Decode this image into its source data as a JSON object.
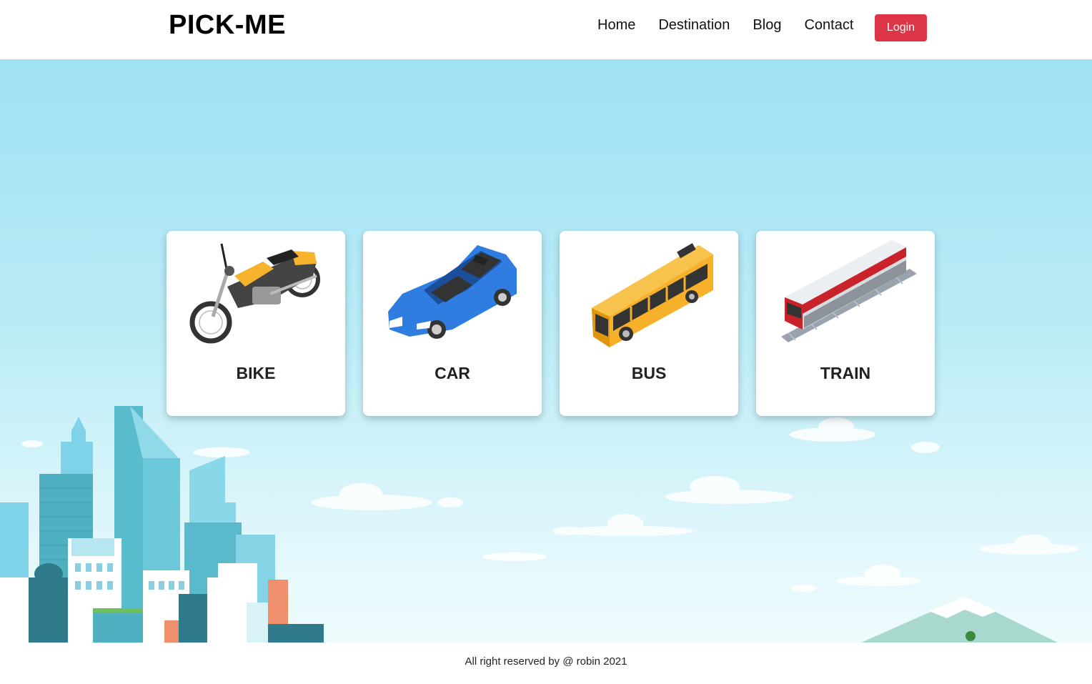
{
  "header": {
    "brand": "PICK-ME",
    "nav": [
      "Home",
      "Destination",
      "Blog",
      "Contact"
    ],
    "login_label": "Login",
    "login_color": "#dc3545"
  },
  "cards": [
    {
      "title": "BIKE",
      "icon": "motorbike-icon"
    },
    {
      "title": "CAR",
      "icon": "car-icon"
    },
    {
      "title": "BUS",
      "icon": "bus-icon"
    },
    {
      "title": "TRAIN",
      "icon": "train-icon"
    }
  ],
  "footer": {
    "text": "All right reserved by @ robin 2021"
  },
  "colors": {
    "sky_top": "#9fe1f2",
    "sky_bottom": "#eefbfd"
  }
}
